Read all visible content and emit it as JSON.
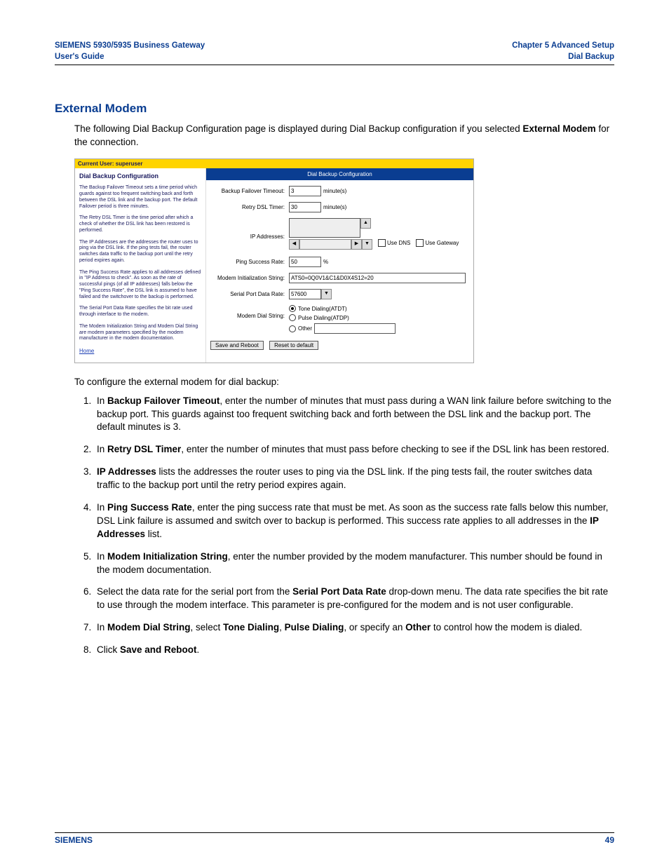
{
  "header": {
    "left_line1": "SIEMENS 5930/5935 Business Gateway",
    "left_line2": "User's Guide",
    "right_line1": "Chapter 5  Advanced Setup",
    "right_line2": "Dial Backup"
  },
  "section_title": "External Modem",
  "intro_part1": "The following Dial Backup Configuration page is displayed during Dial Backup configuration if you selected ",
  "intro_bold": "External Modem",
  "intro_part2": " for the connection.",
  "screenshot": {
    "current_user": "Current User: superuser",
    "left_title": "Dial Backup Configuration",
    "left_paragraphs": [
      "The Backup Failover Timeout sets a time period which guards against too frequent switching back and forth between the DSL link and the backup port. The default Failover period is three minutes.",
      "The Retry DSL Timer is the time period after which a check of whether the DSL link has been restored is performed.",
      "The IP Addresses are the addresses the router uses to ping via the DSL link. If the ping tests fail, the router switches data traffic to the backup port until the retry period expires again.",
      "The Ping Success Rate applies to all addresses defined in \"IP Address to check\". As soon as the rate of successful pings (of all IP addresses) falls below the \"Ping Success Rate\", the DSL link is assumed to have failed and the switchover to the backup is performed.",
      "The Serial Port Data Rate specifies the bit rate used through interface to the modem.",
      "The Modem Initialization String and Modem Dial String are modem parameters specified by the modem manufacturer in the modem documentation."
    ],
    "home_link": "Home",
    "panel_title": "Dial Backup Configuration",
    "labels": {
      "failover": "Backup Failover Timeout:",
      "retry": "Retry DSL Timer:",
      "ip": "IP Addresses:",
      "ping": "Ping Success Rate:",
      "init": "Modem Initialization String:",
      "serial": "Serial Port Data Rate:",
      "dial": "Modem Dial String:"
    },
    "values": {
      "failover": "3",
      "retry": "30",
      "ping": "50",
      "init": "ATS0=0Q0V1&C1&D0X4S12=20",
      "serial": "57600",
      "minutes_unit": "minute(s)",
      "percent_unit": "%",
      "use_dns": "Use DNS",
      "use_gateway": "Use Gateway",
      "tone": "Tone Dialing(ATDT)",
      "pulse": "Pulse Dialing(ATDP)",
      "other": "Other",
      "save_btn": "Save and Reboot",
      "reset_btn": "Reset to default"
    }
  },
  "instruction_lead": "To configure the external modem for dial backup:",
  "steps": {
    "s1a": "In ",
    "s1b": "Backup Failover Timeout",
    "s1c": ", enter the number of minutes that must pass during a WAN link failure before switching to the backup port. This guards against too frequent switching back and forth between the DSL link and the backup port. The default minutes is 3.",
    "s2a": "In ",
    "s2b": "Retry DSL Timer",
    "s2c": ", enter the number of minutes that must pass before checking to see if the DSL link has been restored.",
    "s3a": "",
    "s3b": "IP Addresses",
    "s3c": " lists the addresses the router uses to ping via the DSL link. If the ping tests fail, the router switches data traffic to the backup port until the retry period expires again.",
    "s4a": "In ",
    "s4b": "Ping Success Rate",
    "s4c": ", enter the ping success rate that must be met. As soon as the success rate falls below this number, DSL Link failure is assumed and switch over to backup is performed. This success rate applies to all addresses in the ",
    "s4d": "IP Addresses",
    "s4e": " list.",
    "s5a": "In ",
    "s5b": "Modem Initialization String",
    "s5c": ", enter the number provided by the modem manufacturer. This number should be found in the modem documentation.",
    "s6a": "Select the data rate for the serial port from the ",
    "s6b": "Serial Port Data Rate",
    "s6c": " drop-down menu. The data rate specifies the bit rate to use through the modem interface. This parameter is pre-configured for the modem and is not user configurable.",
    "s7a": "In ",
    "s7b": "Modem Dial String",
    "s7c": ", select ",
    "s7d": "Tone Dialing",
    "s7e": ", ",
    "s7f": "Pulse Dialing",
    "s7g": ", or specify an ",
    "s7h": "Other",
    "s7i": " to control how the modem is dialed.",
    "s8a": "Click ",
    "s8b": "Save and Reboot",
    "s8c": "."
  },
  "footer": {
    "left": "SIEMENS",
    "right": "49"
  }
}
